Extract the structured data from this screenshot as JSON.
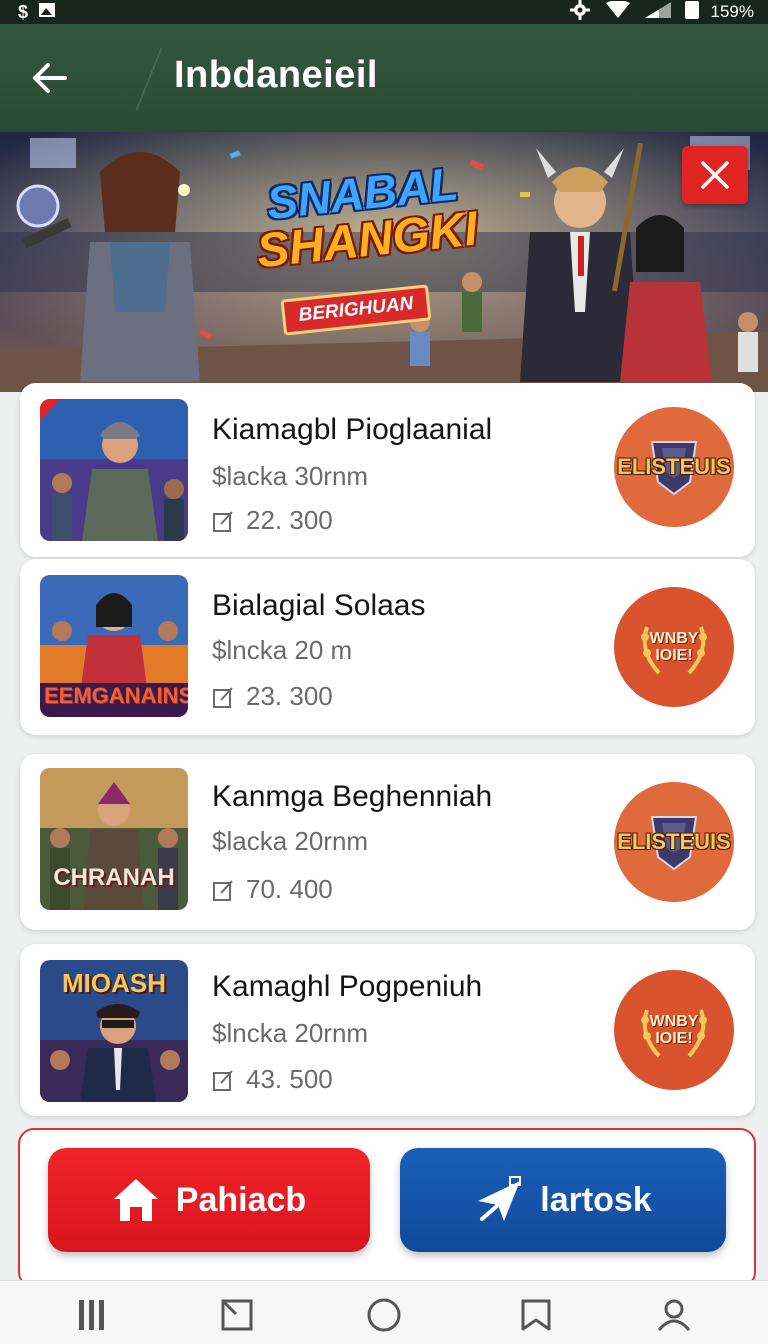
{
  "status_bar": {
    "left_icons": [
      "dollar-icon",
      "image-icon"
    ],
    "battery_text": "159%"
  },
  "app_bar": {
    "title": "Inbdaneieil"
  },
  "hero": {
    "title_line1": "SNABAL",
    "title_line2": "SHANGKI",
    "ribbon": "BERIGHUAN"
  },
  "games": [
    {
      "title": "Kiamagbl Pioglaanial",
      "subtitle": "$lacka 30rnm",
      "count": "22. 300",
      "thumb_text": "",
      "badge_text": "ELISTEUIS",
      "badge_type": "shield"
    },
    {
      "title": "Bialagial Solaas",
      "subtitle": "$lncka 20  m",
      "count": "23. 300",
      "thumb_text": "EEMGANAINS",
      "badge_text": "WNBY IOIE!",
      "badge_type": "laurel"
    },
    {
      "title": "Kanmga Beghenniah",
      "subtitle": "$lacka 20rnm",
      "count": "70. 400",
      "thumb_text": "CHRANAH",
      "badge_text": "ELISTEUIS",
      "badge_type": "shield"
    },
    {
      "title": "Kamaghl Pogpeniuh",
      "subtitle": "$lncka 20rnm",
      "count": "43. 500",
      "thumb_text": "MIOASH",
      "badge_text": "WNBY IOIE!",
      "badge_type": "laurel"
    }
  ],
  "actions": {
    "primary_label": "Pahiacb",
    "secondary_label": "lartosk"
  },
  "bottom_nav": [
    "menu-icon",
    "square-icon",
    "home-circle-icon",
    "bookmark-icon",
    "profile-icon"
  ],
  "colors": {
    "app_bar": "#2f4f39",
    "primary_button": "#e61e25",
    "secondary_button": "#1452a8",
    "badge": "#d9542e"
  }
}
